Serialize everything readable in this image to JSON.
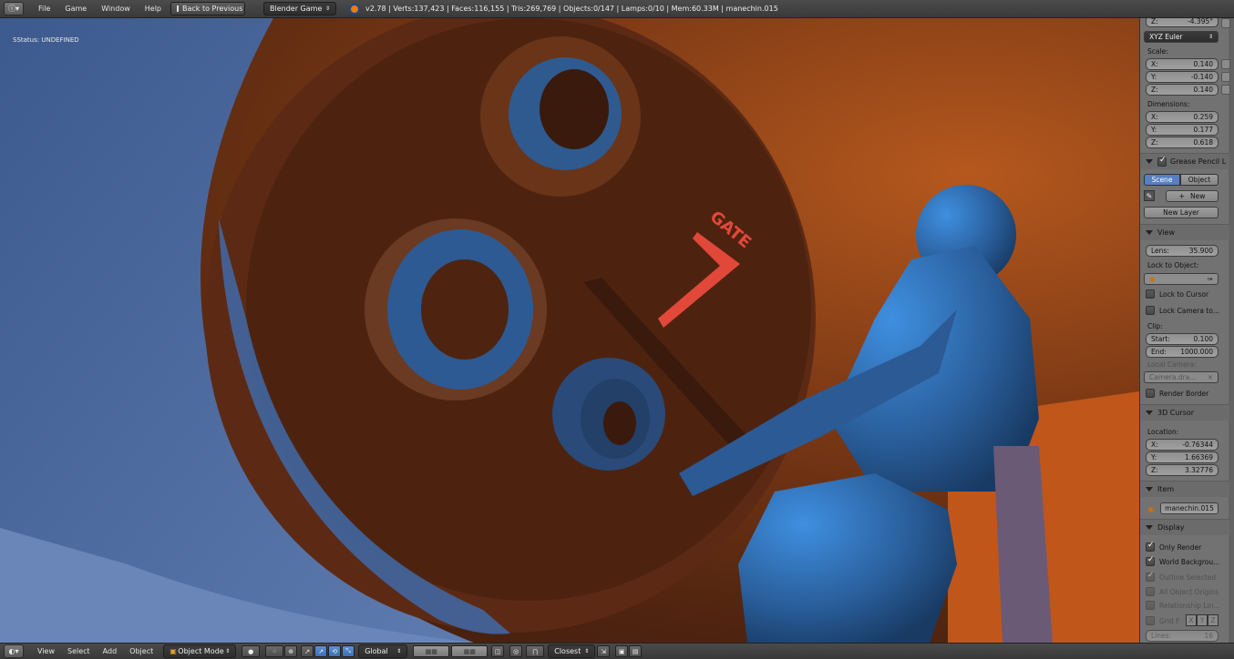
{
  "topbar": {
    "editor_icon": "info-editor-icon",
    "menus": [
      "File",
      "Game",
      "Window",
      "Help"
    ],
    "back_button": "Back to Previous",
    "engine_select": "Blender Game",
    "stats": "v2.78 | Verts:137,423 | Faces:116,155 | Tris:269,769 | Objects:0/147 | Lamps:0/10 | Mem:60.33M | manechin.015"
  },
  "viewport": {
    "status": "SStatus: UNDEFINED",
    "sign_text": "GATE"
  },
  "panel": {
    "rotation_z": {
      "label": "Z:",
      "value": "-4.395°"
    },
    "rotation_mode": "XYZ Euler",
    "scale_label": "Scale:",
    "scale": [
      {
        "label": "X:",
        "value": "0.140"
      },
      {
        "label": "Y:",
        "value": "-0.140"
      },
      {
        "label": "Z:",
        "value": "0.140"
      }
    ],
    "dimensions_label": "Dimensions:",
    "dimensions": [
      {
        "label": "X:",
        "value": "0.259"
      },
      {
        "label": "Y:",
        "value": "0.177"
      },
      {
        "label": "Z:",
        "value": "0.618"
      }
    ],
    "grease_pencil": {
      "title": "Grease Pencil L",
      "tab_scene": "Scene",
      "tab_object": "Object",
      "new_button": "New",
      "new_layer_button": "New Layer"
    },
    "view": {
      "title": "View",
      "lens_label": "Lens:",
      "lens_value": "35.900",
      "lock_to_object": "Lock to Object:",
      "lock_to_cursor": "Lock to Cursor",
      "lock_camera": "Lock Camera to...",
      "clip_label": "Clip:",
      "clip_start_label": "Start:",
      "clip_start": "0.100",
      "clip_end_label": "End:",
      "clip_end": "1000.000",
      "local_camera_label": "Local Camera:",
      "local_camera_value": "Camera.dra...",
      "render_border": "Render Border"
    },
    "cursor": {
      "title": "3D Cursor",
      "location_label": "Location:",
      "x": {
        "label": "X:",
        "value": "-0.76344"
      },
      "y": {
        "label": "Y:",
        "value": "1.66369"
      },
      "z": {
        "label": "Z:",
        "value": "3.32776"
      }
    },
    "item": {
      "title": "Item",
      "name": "manechin.015"
    },
    "display": {
      "title": "Display",
      "only_render": "Only Render",
      "world_background": "World Backgrou...",
      "outline_selected": "Outline Selected",
      "all_object_origins": "All Object Origins",
      "relationship_lines": "Relationship Lin...",
      "grid_floor": "Grid F",
      "axis_x": "X",
      "axis_y": "Y",
      "axis_z": "Z",
      "lines_label": "Lines:",
      "lines_value": "16"
    }
  },
  "bottombar": {
    "menus": [
      "View",
      "Select",
      "Add",
      "Object"
    ],
    "mode": "Object Mode",
    "orientation": "Global",
    "snap_target": "Closest"
  },
  "colors": {
    "panel_bg": "#727272",
    "header_bg": "#444444",
    "tab_active": "#5680c2",
    "sign_red": "#e2483a"
  }
}
